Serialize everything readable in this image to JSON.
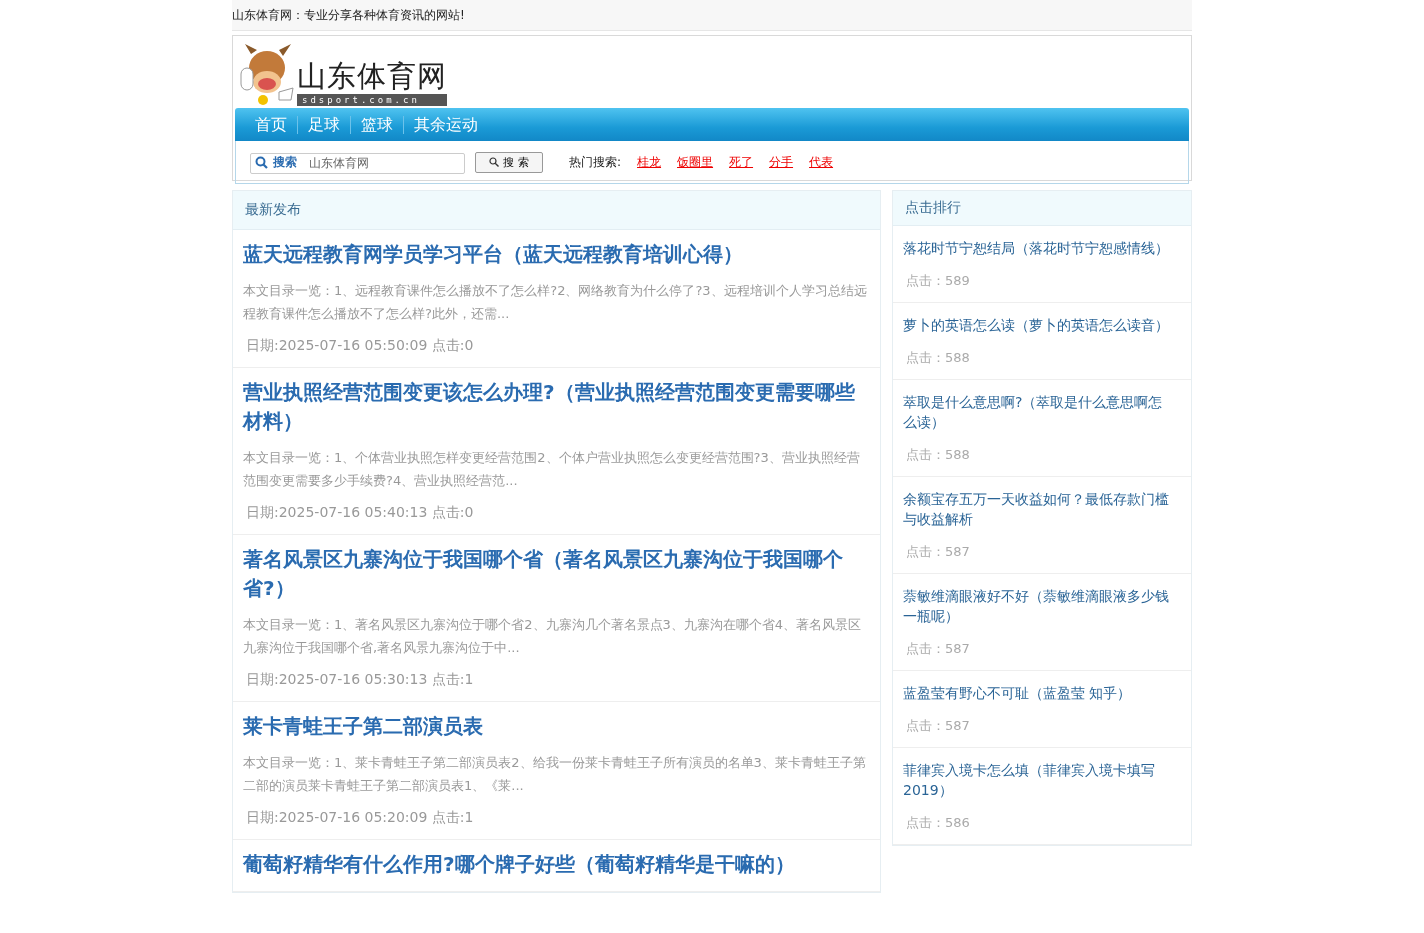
{
  "top_bar": {
    "text": "山东体育网：专业分享各种体育资讯的网站!"
  },
  "logo": {
    "title": "山东体育网",
    "domain": "sdsport.com.cn"
  },
  "nav": [
    "首页",
    "足球",
    "篮球",
    "其余运动"
  ],
  "search": {
    "label": "搜索",
    "value": "山东体育网",
    "button": "搜 索",
    "hot_label": "热门搜索:",
    "hot_terms": [
      "桂龙",
      "饭圈里",
      "死了",
      "分手",
      "代表"
    ]
  },
  "latest": {
    "heading": "最新发布",
    "articles": [
      {
        "title": "蓝天远程教育网学员学习平台（蓝天远程教育培训心得）",
        "excerpt": "本文目录一览：1、远程教育课件怎么播放不了怎么样?2、网络教育为什么停了?3、远程培训个人学习总结远程教育课件怎么播放不了怎么样?此外，还需...",
        "meta": "日期:2025-07-16 05:50:09 点击:0"
      },
      {
        "title": "营业执照经营范围变更该怎么办理?（营业执照经营范围变更需要哪些材料）",
        "excerpt": "本文目录一览：1、个体营业执照怎样变更经营范围2、个体户营业执照怎么变更经营范围?3、营业执照经营范围变更需要多少手续费?4、营业执照经营范...",
        "meta": "日期:2025-07-16 05:40:13 点击:0"
      },
      {
        "title": "著名风景区九寨沟位于我国哪个省（著名风景区九寨沟位于我国哪个省?）",
        "excerpt": "本文目录一览：1、著名风景区九寨沟位于哪个省2、九寨沟几个著名景点3、九寨沟在哪个省4、著名风景区九寨沟位于我国哪个省,著名风景九寨沟位于中...",
        "meta": "日期:2025-07-16 05:30:13 点击:1"
      },
      {
        "title": "莱卡青蛙王子第二部演员表",
        "excerpt": "本文目录一览：1、莱卡青蛙王子第二部演员表2、给我一份莱卡青蛙王子所有演员的名单3、莱卡青蛙王子第二部的演员莱卡青蛙王子第二部演员表1、《莱...",
        "meta": "日期:2025-07-16 05:20:09 点击:1"
      },
      {
        "title": "葡萄籽精华有什么作用?哪个牌子好些（葡萄籽精华是干嘛的）"
      }
    ]
  },
  "ranking": {
    "heading": "点击排行",
    "items": [
      {
        "title": "落花时节宁恕结局（落花时节宁恕感情线）",
        "clicks": "点击：589"
      },
      {
        "title": "萝卜的英语怎么读（萝卜的英语怎么读音）",
        "clicks": "点击：588"
      },
      {
        "title": "萃取是什么意思啊?（萃取是什么意思啊怎么读）",
        "clicks": "点击：588"
      },
      {
        "title": "余额宝存五万一天收益如何？最低存款门槛与收益解析",
        "clicks": "点击：587"
      },
      {
        "title": "萘敏维滴眼液好不好（萘敏维滴眼液多少钱一瓶呢）",
        "clicks": "点击：587"
      },
      {
        "title": "蓝盈莹有野心不可耻（蓝盈莹 知乎）",
        "clicks": "点击：587"
      },
      {
        "title": "菲律宾入境卡怎么填（菲律宾入境卡填写2019）",
        "clicks": "点击：586"
      }
    ]
  }
}
